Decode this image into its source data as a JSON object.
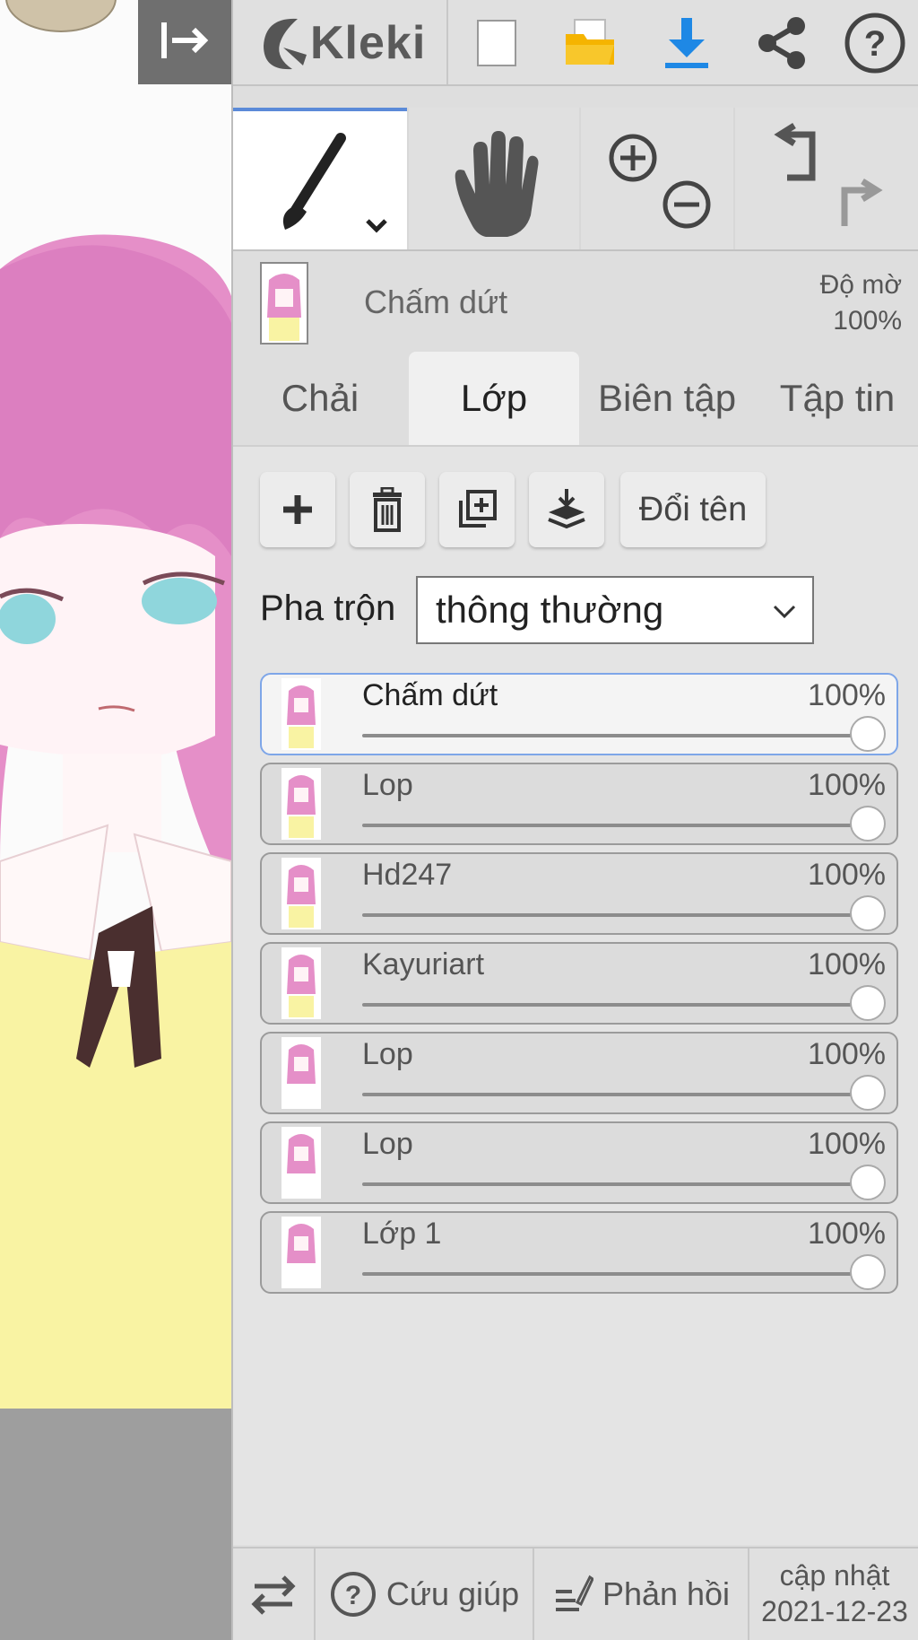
{
  "app": {
    "name": "Kleki"
  },
  "top_bar": {
    "icons": [
      "collapse-icon",
      "new-file-icon",
      "open-folder-icon",
      "download-icon",
      "share-icon",
      "help-icon"
    ]
  },
  "layer_preview": {
    "name": "Chấm dứt",
    "opacity_label": "Độ mờ",
    "opacity_value": "100%"
  },
  "tabs": [
    {
      "label": "Chải",
      "active": false
    },
    {
      "label": "Lớp",
      "active": true
    },
    {
      "label": "Biên tập",
      "active": false
    },
    {
      "label": "Tập tin",
      "active": false
    }
  ],
  "actions": {
    "rename_label": "Đổi tên"
  },
  "blend": {
    "label": "Pha trộn",
    "value": "thông thường"
  },
  "layers": [
    {
      "name": "Chấm dứt",
      "opacity": "100%",
      "selected": true
    },
    {
      "name": "Lop",
      "opacity": "100%",
      "selected": false
    },
    {
      "name": "Hd247",
      "opacity": "100%",
      "selected": false
    },
    {
      "name": "Kayuriart",
      "opacity": "100%",
      "selected": false
    },
    {
      "name": "Lop",
      "opacity": "100%",
      "selected": false
    },
    {
      "name": "Lop",
      "opacity": "100%",
      "selected": false
    },
    {
      "name": "Lớp 1",
      "opacity": "100%",
      "selected": false
    }
  ],
  "bottom_bar": {
    "help_label": "Cứu giúp",
    "feedback_label": "Phản hồi",
    "update_label": "cập nhật",
    "update_date": "2021-12-23"
  },
  "colors": {
    "accent": "#5b8ad8",
    "download": "#1e88e5",
    "folder": "#f5b400"
  }
}
